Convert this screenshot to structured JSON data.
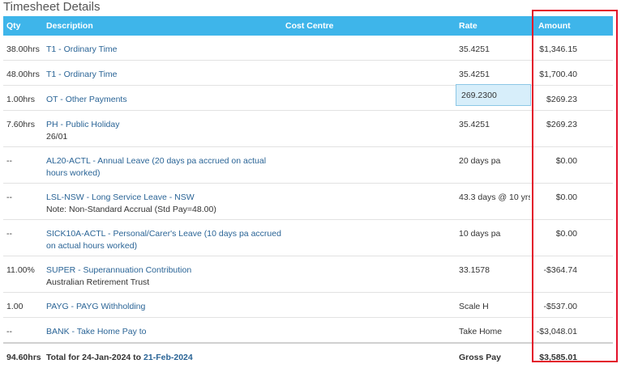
{
  "title": "Timesheet Details",
  "columns": {
    "qty": "Qty",
    "description": "Description",
    "cost_centre": "Cost Centre",
    "rate": "Rate",
    "amount": "Amount"
  },
  "rows": [
    {
      "qty": "38.00hrs",
      "desc": "T1 - Ordinary Time",
      "sub": "",
      "rate": "35.4251",
      "amount": "$1,346.15"
    },
    {
      "qty": "48.00hrs",
      "desc": "T1 - Ordinary Time",
      "sub": "",
      "rate": "35.4251",
      "amount": "$1,700.40"
    },
    {
      "qty": "1.00hrs",
      "desc": "OT - Other Payments",
      "sub": "",
      "rate": "269.2300",
      "amount": "$269.23"
    },
    {
      "qty": "7.60hrs",
      "desc": "PH - Public Holiday",
      "sub": "26/01",
      "rate": "35.4251",
      "amount": "$269.23"
    },
    {
      "qty": "--",
      "desc": "AL20-ACTL - Annual Leave (20 days pa accrued on actual hours worked)",
      "sub": "",
      "rate": "20 days pa",
      "amount": "$0.00"
    },
    {
      "qty": "--",
      "desc": "LSL-NSW - Long Service Leave - NSW",
      "sub": "Note: Non-Standard Accrual (Std Pay=48.00)",
      "rate": "43.3 days @ 10 yrs",
      "amount": "$0.00"
    },
    {
      "qty": "--",
      "desc": "SICK10A-ACTL - Personal/Carer's Leave (10 days pa accrued on actual hours worked)",
      "sub": "",
      "rate": "10 days pa",
      "amount": "$0.00"
    },
    {
      "qty": "11.00%",
      "desc": "SUPER - Superannuation Contribution",
      "sub": "Australian Retirement Trust",
      "rate": "33.1578",
      "amount": "-$364.74"
    },
    {
      "qty": "1.00",
      "desc": "PAYG - PAYG Withholding",
      "sub": "",
      "rate": "Scale H",
      "amount": "-$537.00"
    },
    {
      "qty": "--",
      "desc": "BANK - Take Home Pay to",
      "sub": "",
      "rate": "Take Home",
      "amount": "-$3,048.01"
    }
  ],
  "total": {
    "qty": "94.60hrs",
    "prefix": "Total for 24-Jan-2024 to ",
    "end_date": "21-Feb-2024",
    "rate": "Gross Pay",
    "amount": "$3,585.01"
  }
}
